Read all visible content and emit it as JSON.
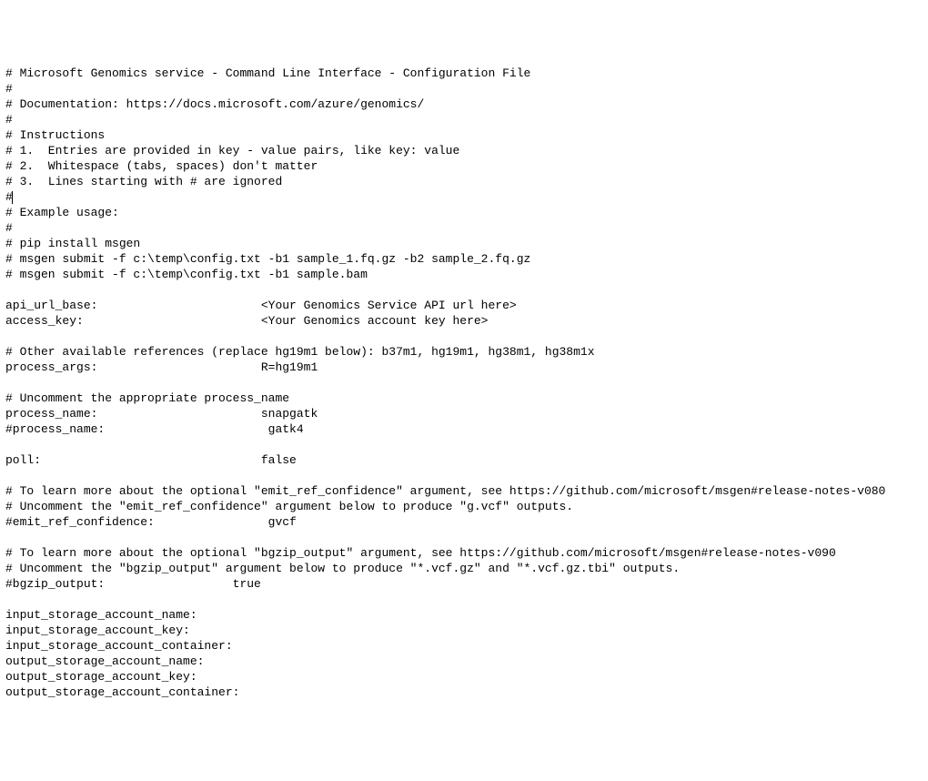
{
  "lines": [
    "# Microsoft Genomics service - Command Line Interface - Configuration File",
    "#",
    "# Documentation: https://docs.microsoft.com/azure/genomics/",
    "#",
    "# Instructions",
    "# 1.  Entries are provided in key - value pairs, like key: value",
    "# 2.  Whitespace (tabs, spaces) don't matter",
    "# 3.  Lines starting with # are ignored",
    "#",
    "# Example usage:",
    "#",
    "# pip install msgen",
    "# msgen submit -f c:\\temp\\config.txt -b1 sample_1.fq.gz -b2 sample_2.fq.gz",
    "# msgen submit -f c:\\temp\\config.txt -b1 sample.bam",
    "",
    "api_url_base:                       <Your Genomics Service API url here>",
    "access_key:                         <Your Genomics account key here>",
    "",
    "# Other available references (replace hg19m1 below): b37m1, hg19m1, hg38m1, hg38m1x",
    "process_args:                       R=hg19m1",
    "",
    "# Uncomment the appropriate process_name",
    "process_name:                       snapgatk",
    "#process_name:                       gatk4",
    "",
    "poll:                               false",
    "",
    "# To learn more about the optional \"emit_ref_confidence\" argument, see https://github.com/microsoft/msgen#release-notes-v080",
    "# Uncomment the \"emit_ref_confidence\" argument below to produce \"g.vcf\" outputs.",
    "#emit_ref_confidence:                gvcf",
    "",
    "# To learn more about the optional \"bgzip_output\" argument, see https://github.com/microsoft/msgen#release-notes-v090",
    "# Uncomment the \"bgzip_output\" argument below to produce \"*.vcf.gz\" and \"*.vcf.gz.tbi\" outputs.",
    "#bgzip_output:                  true",
    "",
    "input_storage_account_name:",
    "input_storage_account_key:",
    "input_storage_account_container:",
    "output_storage_account_name:",
    "output_storage_account_key:",
    "output_storage_account_container:"
  ],
  "cursor_line_index": 8
}
